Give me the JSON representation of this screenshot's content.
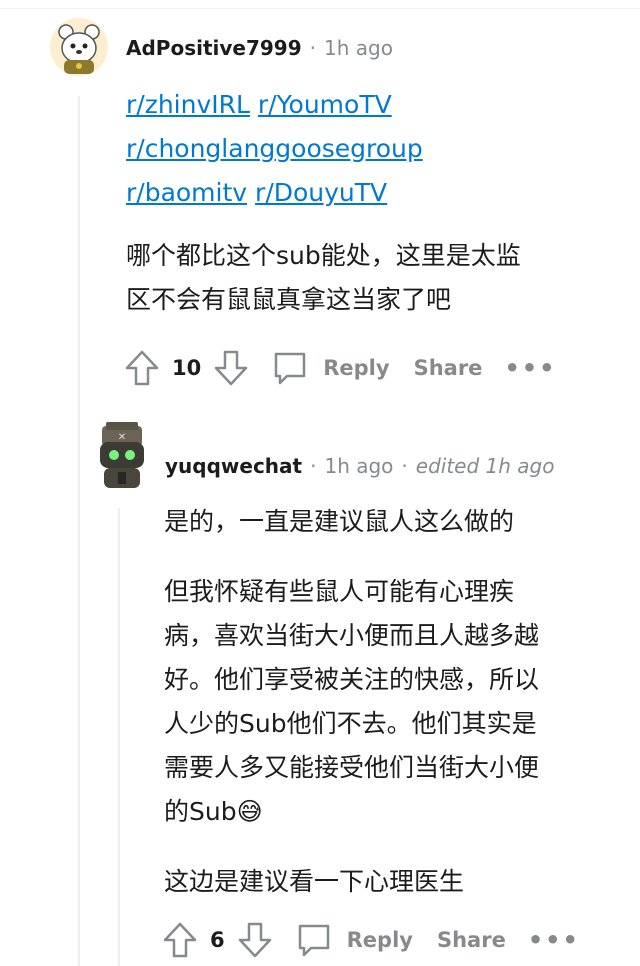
{
  "comment1": {
    "username": "AdPositive7999",
    "separator": "·",
    "time": "1h ago",
    "links": [
      "r/zhinvIRL",
      "r/YoumoTV",
      "r/chonglanggoosegroup",
      "r/baomitv",
      "r/DouyuTV"
    ],
    "text_line1": "哪个都比这个sub能处，这里是太监",
    "text_line2": "区不会有鼠鼠真拿这当家了吧",
    "votes": "10",
    "reply_label": "Reply",
    "share_label": "Share",
    "more_label": "•••"
  },
  "comment2": {
    "username": "yuqqwechat",
    "separator": "·",
    "time": "1h ago",
    "separator2": "·",
    "edited": "edited 1h ago",
    "para1": "是的，一直是建议鼠人这么做的",
    "para2_line1": "但我怀疑有些鼠人可能有心理疾",
    "para2_line2": "病，喜欢当街大小便而且人越多越",
    "para2_line3": "好。他们享受被关注的快感，所以",
    "para2_line4": "人少的Sub他们不去。他们其实是",
    "para2_line5": "需要人多又能接受他们当街大小便",
    "para2_line6": "的Sub",
    "emoji": "😅",
    "para3": "这边是建议看一下心理医生",
    "votes": "6",
    "reply_label": "Reply",
    "share_label": "Share",
    "more_label": "•••"
  },
  "colors": {
    "link": "#0079d3",
    "meta_gray": "#878a8c",
    "thread_line": "#edeff1",
    "text": "#1c1c1c"
  },
  "icons": [
    "upvote-icon",
    "downvote-icon",
    "comment-bubble-icon",
    "more-dots-icon",
    "avatar-bear",
    "avatar-robot"
  ]
}
